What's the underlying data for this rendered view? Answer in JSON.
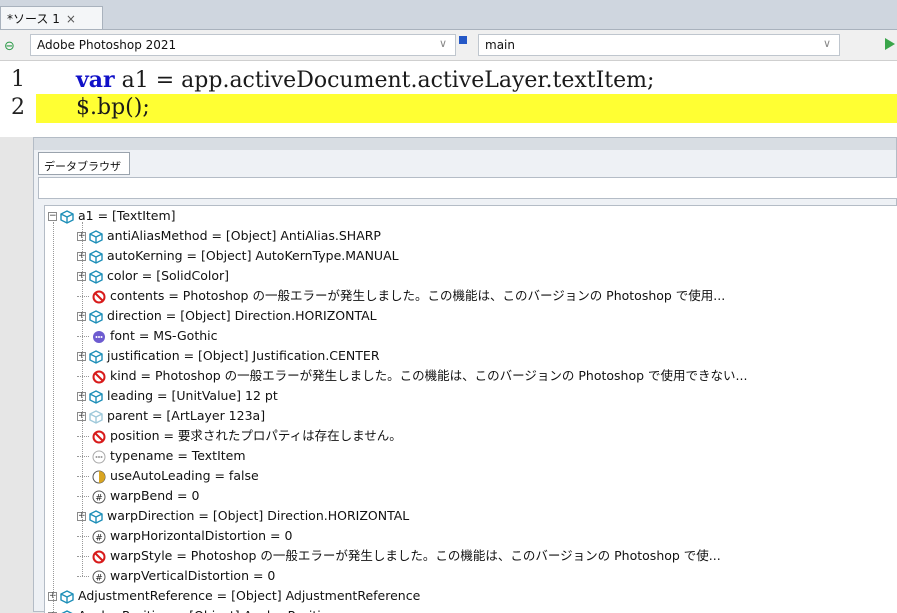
{
  "tab": {
    "label": "*ソース 1",
    "close": "×"
  },
  "toolbar": {
    "target_app": "Adobe Photoshop 2021",
    "engine": "main"
  },
  "editor": {
    "lines": [
      {
        "num": "1",
        "kw": "var",
        "rest": " a1 = app.activeDocument.activeLayer.textItem;"
      },
      {
        "num": "2",
        "kw": "",
        "rest": "$.bp();"
      }
    ]
  },
  "panel": {
    "tab_label": "データブラウザ"
  },
  "tree": {
    "root": "a1 = [TextItem]",
    "children": [
      {
        "text": "antiAliasMethod = [Object] AntiAlias.SHARP",
        "icon": "object-icon",
        "expandable": true
      },
      {
        "text": "autoKerning = [Object] AutoKernType.MANUAL",
        "icon": "object-icon",
        "expandable": true
      },
      {
        "text": "color = [SolidColor]",
        "icon": "object-icon",
        "expandable": true
      },
      {
        "text": "contents = Photoshop の一般エラーが発生しました。この機能は、このバージョンの Photoshop で使用...",
        "icon": "error-icon",
        "expandable": false
      },
      {
        "text": "direction = [Object] Direction.HORIZONTAL",
        "icon": "object-icon",
        "expandable": true
      },
      {
        "text": "font = MS-Gothic",
        "icon": "string-icon",
        "expandable": false
      },
      {
        "text": "justification = [Object] Justification.CENTER",
        "icon": "object-icon",
        "expandable": true
      },
      {
        "text": "kind = Photoshop の一般エラーが発生しました。この機能は、このバージョンの Photoshop で使用できない...",
        "icon": "error-icon",
        "expandable": false
      },
      {
        "text": "leading = [UnitValue] 12 pt",
        "icon": "object-icon",
        "expandable": true
      },
      {
        "text": "parent = [ArtLayer 123a]",
        "icon": "object-faded-icon",
        "expandable": true
      },
      {
        "text": "position = 要求されたプロパティは存在しません。",
        "icon": "error-icon",
        "expandable": false
      },
      {
        "text": "typename = TextItem",
        "icon": "string-faded-icon",
        "expandable": false
      },
      {
        "text": "useAutoLeading = false",
        "icon": "boolean-icon",
        "expandable": false
      },
      {
        "text": "warpBend = 0",
        "icon": "number-icon",
        "expandable": false
      },
      {
        "text": "warpDirection = [Object] Direction.HORIZONTAL",
        "icon": "object-icon",
        "expandable": true
      },
      {
        "text": "warpHorizontalDistortion = 0",
        "icon": "number-icon",
        "expandable": false
      },
      {
        "text": "warpStyle = Photoshop の一般エラーが発生しました。この機能は、このバージョンの Photoshop で使...",
        "icon": "error-icon",
        "expandable": false
      },
      {
        "text": "warpVerticalDistortion = 0",
        "icon": "number-icon",
        "expandable": false
      }
    ],
    "siblings": [
      {
        "text": "AdjustmentReference = [Object] AdjustmentReference",
        "icon": "object-icon",
        "expandable": true
      },
      {
        "text": "AnchorPosition = [Object] AnchorPosition",
        "icon": "object-icon",
        "expandable": true
      }
    ]
  },
  "colors": {
    "keyword": "#1010c8",
    "highlight": "#ffff33",
    "object_icon": "#1e8fb8",
    "error_icon": "#d81b1b"
  }
}
